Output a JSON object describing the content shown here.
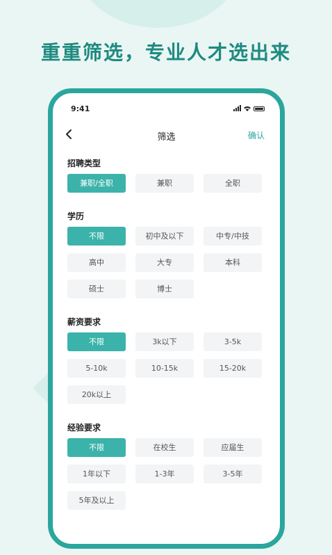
{
  "headline": "重重筛选，专业人才选出来",
  "colors": {
    "accent": "#3cb3aa",
    "frame": "#2aa69d",
    "headline": "#1f8a80"
  },
  "status": {
    "time": "9:41"
  },
  "nav": {
    "title": "筛选",
    "confirm": "确认",
    "back_icon": "chevron-left-icon"
  },
  "sections": [
    {
      "title": "招聘类型",
      "selected": 0,
      "options": [
        "兼职/全职",
        "兼职",
        "全职"
      ]
    },
    {
      "title": "学历",
      "selected": 0,
      "options": [
        "不限",
        "初中及以下",
        "中专/中技",
        "高中",
        "大专",
        "本科",
        "硕士",
        "博士"
      ]
    },
    {
      "title": "薪资要求",
      "selected": 0,
      "options": [
        "不限",
        "3k以下",
        "3-5k",
        "5-10k",
        "10-15k",
        "15-20k",
        "20k以上"
      ]
    },
    {
      "title": "经验要求",
      "selected": 0,
      "options": [
        "不限",
        "在校生",
        "应届生",
        "1年以下",
        "1-3年",
        "3-5年",
        "5年及以上"
      ]
    }
  ]
}
